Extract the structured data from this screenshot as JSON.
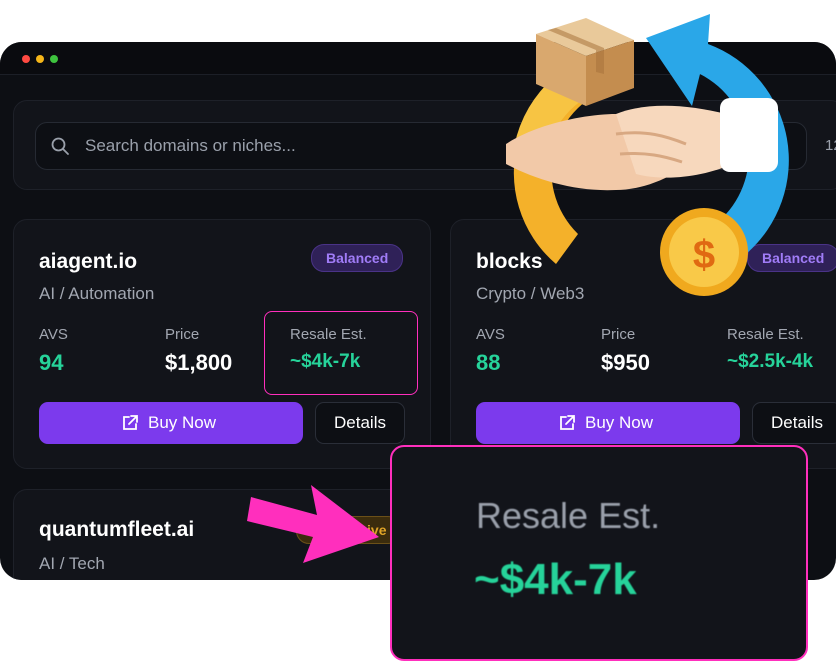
{
  "search": {
    "placeholder": "Search domains or niches...",
    "count_partial": "12"
  },
  "cards": [
    {
      "domain": "aiagent.io",
      "niche": "AI / Automation",
      "badge": "Balanced",
      "avs_label": "AVS",
      "avs": "94",
      "price_label": "Price",
      "price": "$1,800",
      "resale_label": "Resale Est.",
      "resale": "~$4k-7k",
      "buy_label": "Buy Now",
      "details_label": "Details"
    },
    {
      "domain": "blocks",
      "niche": "Crypto / Web3",
      "badge": "Balanced",
      "avs_label": "AVS",
      "avs": "88",
      "price_label": "Price",
      "price": "$950",
      "resale_label": "Resale Est.",
      "resale": "~$2.5k-4k",
      "buy_label": "Buy Now",
      "details_label": "Details"
    },
    {
      "domain": "quantumfleet.ai",
      "niche": "AI / Tech",
      "badge": "Aggressive"
    }
  ],
  "zoom": {
    "label": "Resale Est.",
    "value": "~$4k-7k"
  },
  "colors": {
    "accent": "#7c3aed",
    "green": "#26d39a",
    "highlight": "#ff2fbd",
    "badge_balanced": "#a07cf7",
    "badge_aggressive": "#e0a427"
  },
  "icons": [
    "search-icon",
    "external-link-icon",
    "handshake-illustration",
    "pointer-arrow"
  ]
}
